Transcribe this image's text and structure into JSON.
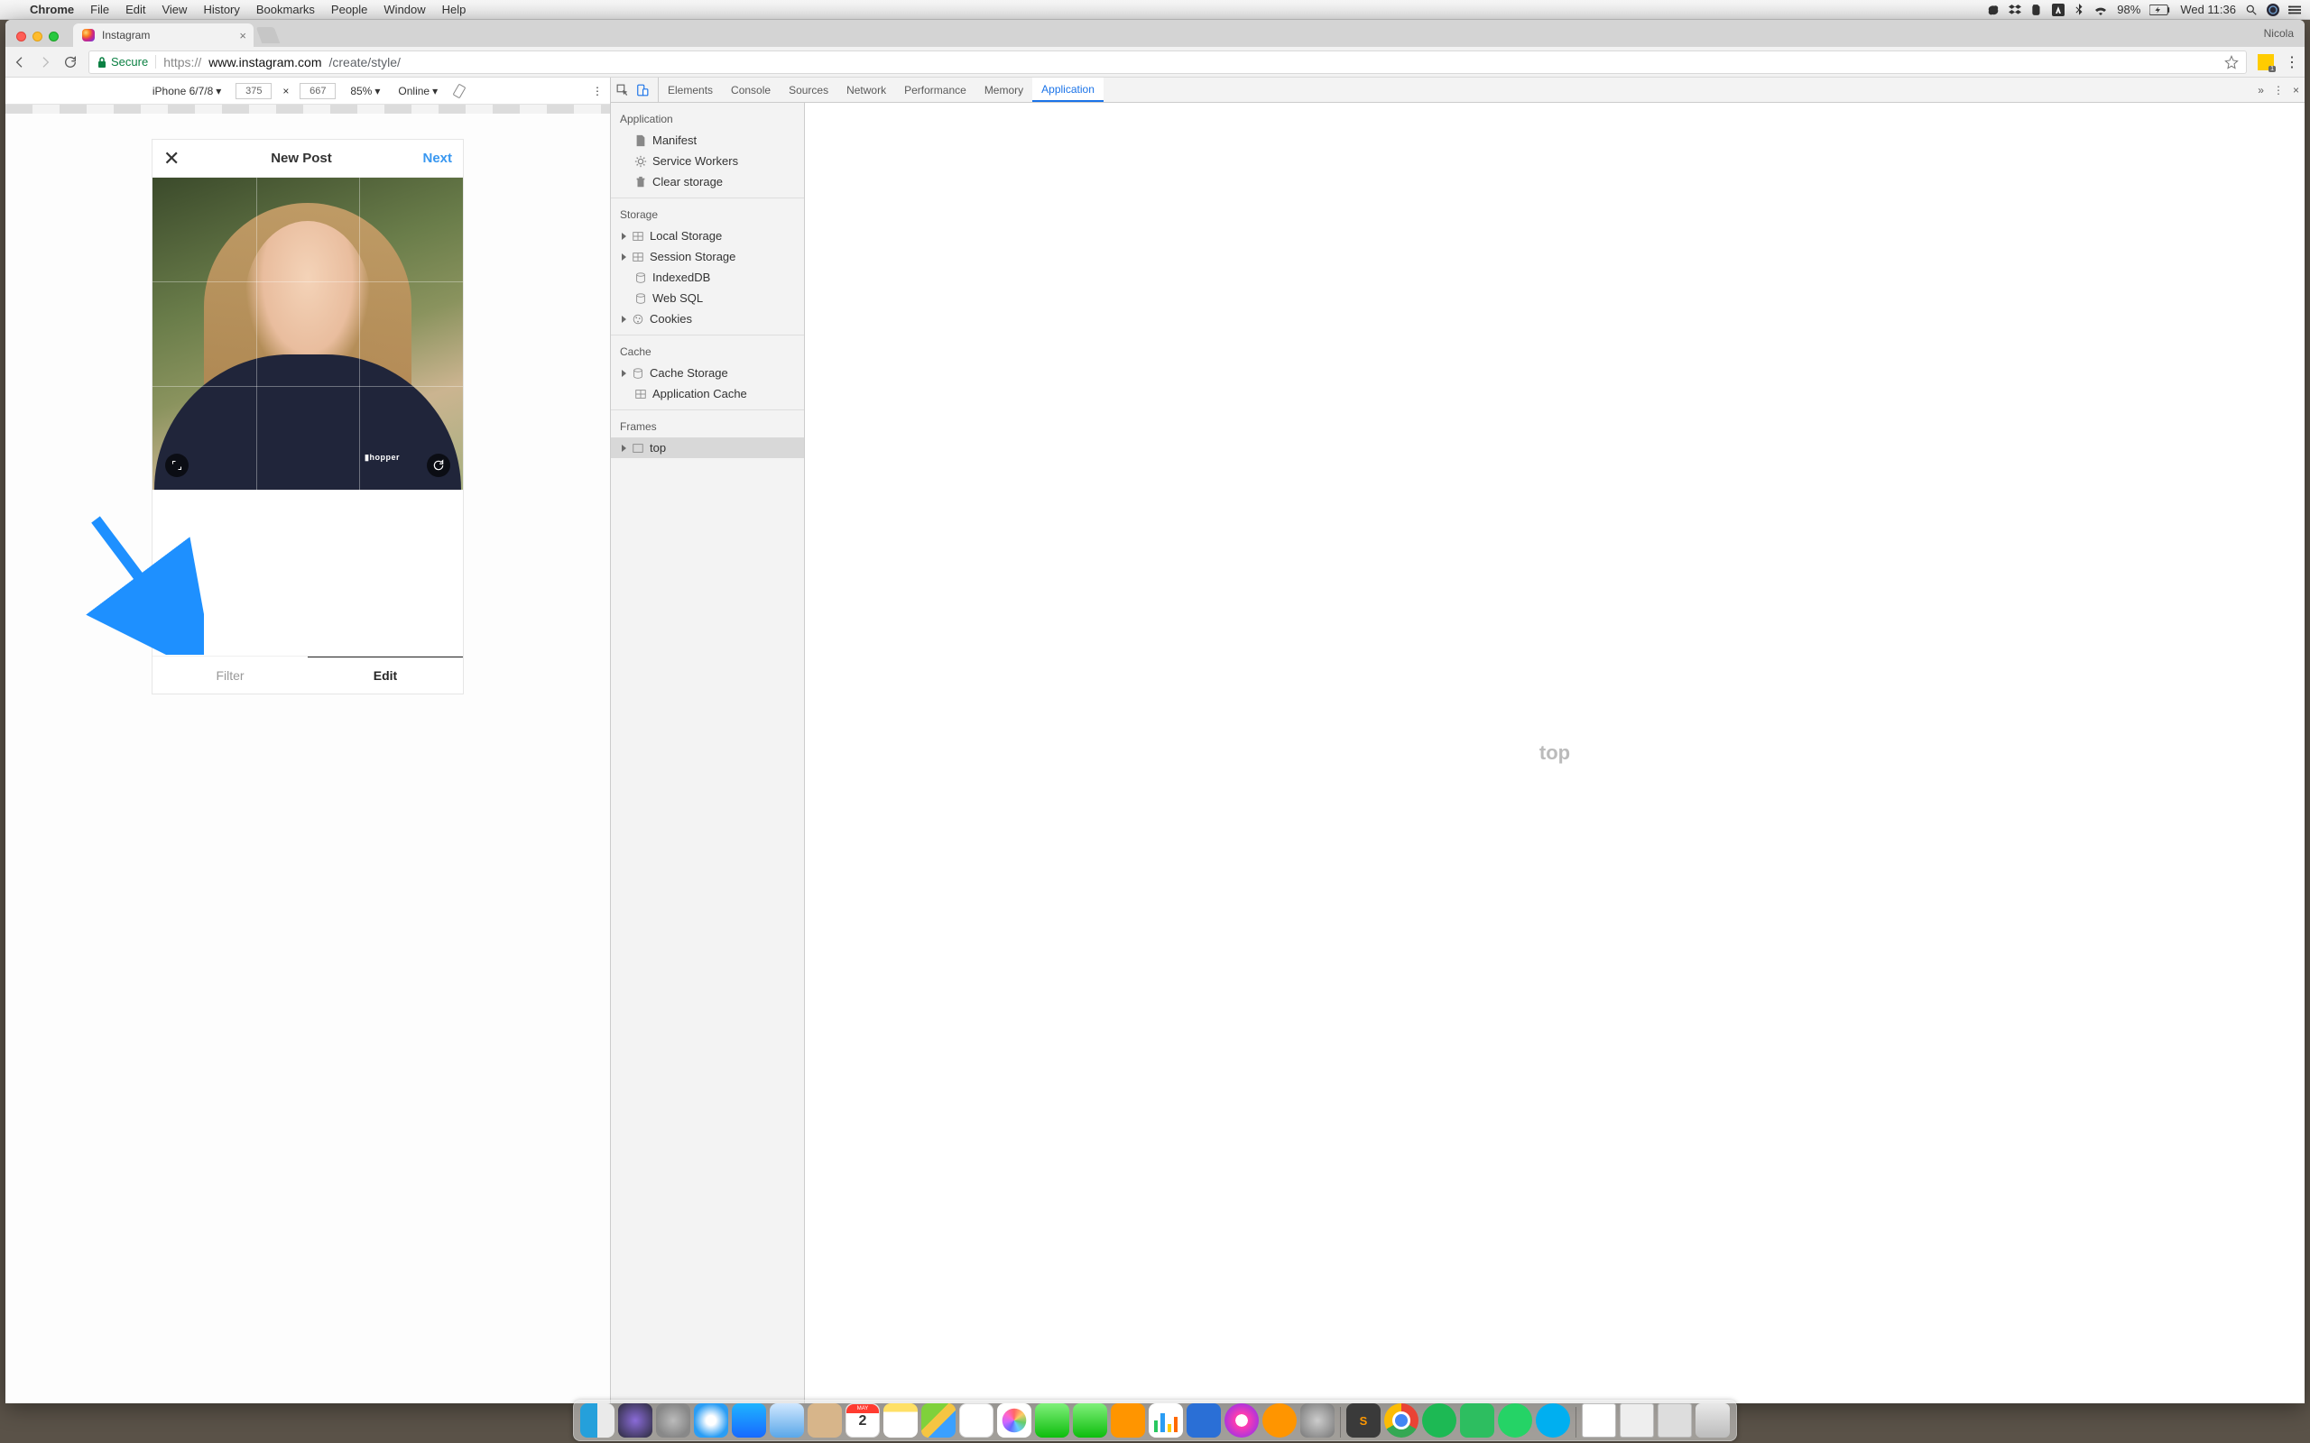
{
  "menubar": {
    "app": "Chrome",
    "items": [
      "File",
      "Edit",
      "View",
      "History",
      "Bookmarks",
      "People",
      "Window",
      "Help"
    ],
    "battery": "98%",
    "clock": "Wed 11:36"
  },
  "chrome": {
    "tab_title": "Instagram",
    "profile": "Nicola",
    "secure_label": "Secure",
    "url_scheme": "https://",
    "url_host": "www.instagram.com",
    "url_path": "/create/style/"
  },
  "device_bar": {
    "device": "iPhone 6/7/8",
    "width": "375",
    "height": "667",
    "zoom": "85%",
    "network": "Online"
  },
  "instagram": {
    "title": "New Post",
    "next": "Next",
    "shirt_logo": "▮hopper",
    "tab_filter": "Filter",
    "tab_edit": "Edit"
  },
  "devtools": {
    "tabs": [
      "Elements",
      "Console",
      "Sources",
      "Network",
      "Performance",
      "Memory",
      "Application"
    ],
    "active_tab": "Application",
    "sections": {
      "application": {
        "title": "Application",
        "items": [
          "Manifest",
          "Service Workers",
          "Clear storage"
        ]
      },
      "storage": {
        "title": "Storage",
        "items": [
          "Local Storage",
          "Session Storage",
          "IndexedDB",
          "Web SQL",
          "Cookies"
        ]
      },
      "cache": {
        "title": "Cache",
        "items": [
          "Cache Storage",
          "Application Cache"
        ]
      },
      "frames": {
        "title": "Frames",
        "items": [
          "top"
        ]
      }
    },
    "main_placeholder": "top"
  }
}
